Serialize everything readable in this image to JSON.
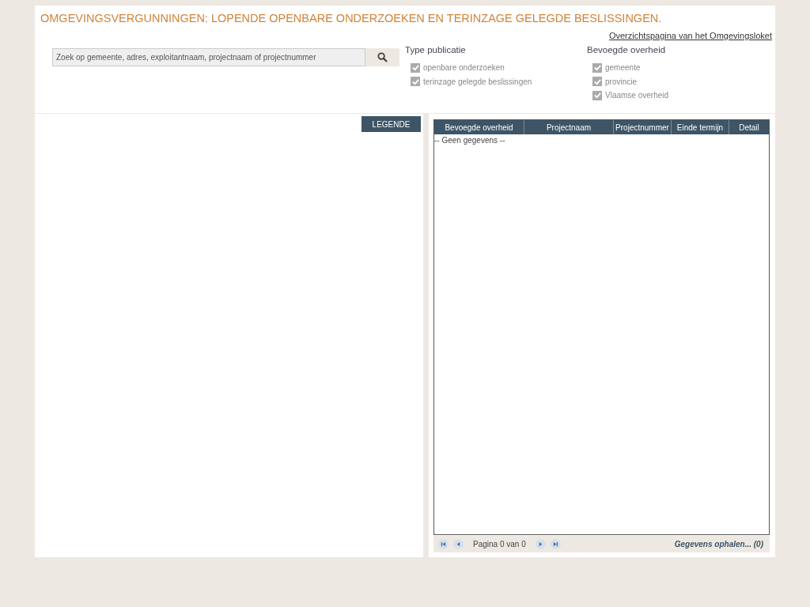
{
  "title": "OMGEVINGSVERGUNNINGEN: LOPENDE OPENBARE ONDERZOEKEN EN TERINZAGE GELEGDE BESLISSINGEN.",
  "overview_link": "Overzichtspagina van het Omgevingsloket",
  "search": {
    "placeholder": "Zoek op gemeente, adres, exploitantnaam, projectnaam of projectnummer"
  },
  "filters": [
    {
      "title": "Type publicatie",
      "options": [
        {
          "label": "openbare onderzoeken",
          "checked": true
        },
        {
          "label": "terinzage gelegde beslissingen",
          "checked": true
        }
      ]
    },
    {
      "title": "Bevoegde overheid",
      "options": [
        {
          "label": "gemeente",
          "checked": true
        },
        {
          "label": "provincie",
          "checked": true
        },
        {
          "label": "Vlaamse overheid",
          "checked": true
        }
      ]
    }
  ],
  "map": {
    "legend_button": "LEGENDE"
  },
  "table": {
    "columns": [
      "Bevoegde overheid",
      "Projectnaam",
      "Projectnummer",
      "Einde termijn",
      "Detail"
    ],
    "empty_text": "-- Geen gegevens --"
  },
  "pager": {
    "page_text": "Pagina 0 van 0",
    "status": "Gegevens ophalen... (0)"
  }
}
